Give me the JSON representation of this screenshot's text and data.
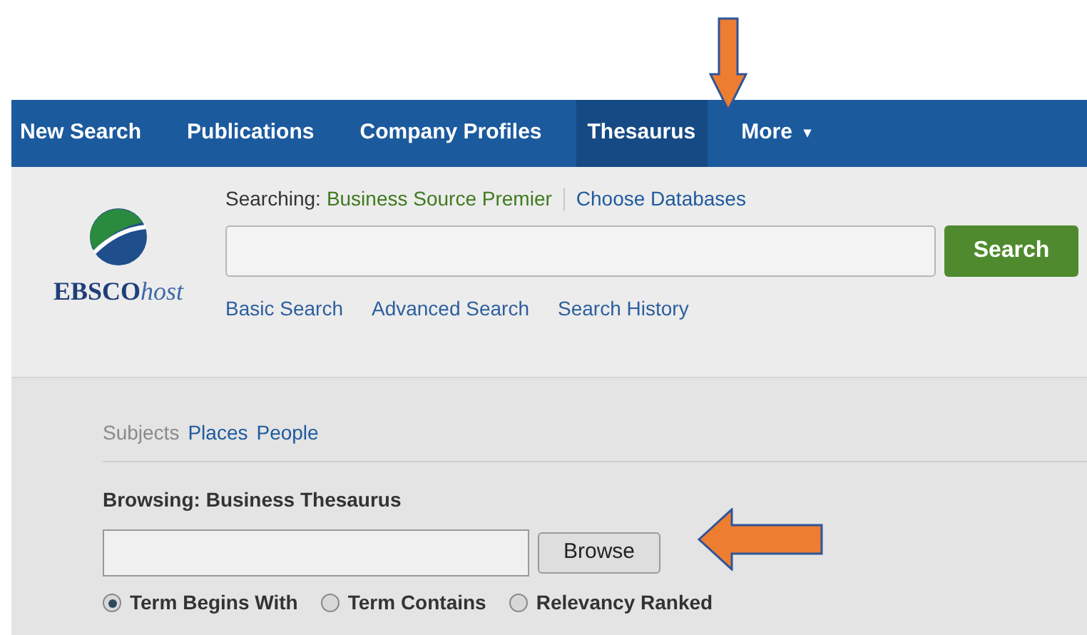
{
  "nav": [
    {
      "label": "New Search",
      "selected": false
    },
    {
      "label": "Publications",
      "selected": false
    },
    {
      "label": "Company Profiles",
      "selected": false
    },
    {
      "label": "Thesaurus",
      "selected": true
    },
    {
      "label": "More",
      "selected": false,
      "caret": "▾"
    }
  ],
  "logo": {
    "brand": "EBSCO",
    "suffix": "host"
  },
  "search": {
    "searching_label": "Searching:",
    "database": "Business Source Premier",
    "choose_link": "Choose Databases",
    "button": "Search",
    "links": [
      "Basic Search",
      "Advanced Search",
      "Search History"
    ]
  },
  "thesaurus_tabs": [
    {
      "label": "Subjects",
      "selected": true
    },
    {
      "label": "Places",
      "selected": false
    },
    {
      "label": "People",
      "selected": false
    }
  ],
  "browse": {
    "label": "Browsing: Business Thesaurus",
    "button": "Browse",
    "options": [
      {
        "label": "Term Begins With",
        "selected": true
      },
      {
        "label": "Term Contains",
        "selected": false
      },
      {
        "label": "Relevancy Ranked",
        "selected": false
      }
    ]
  }
}
